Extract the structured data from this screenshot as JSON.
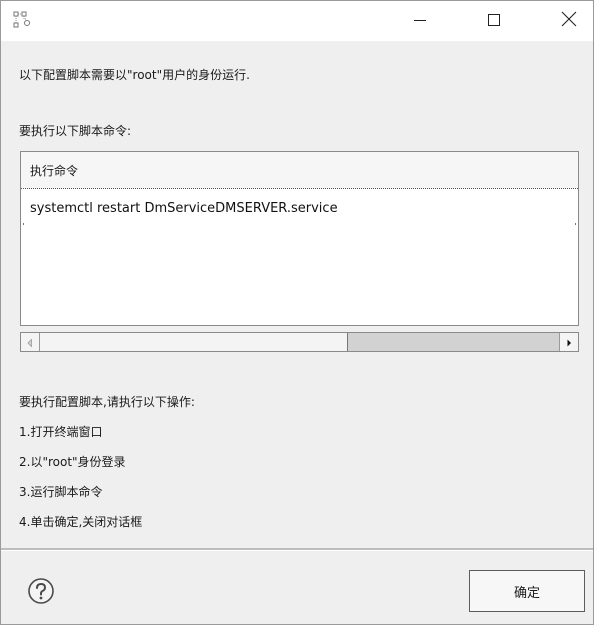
{
  "window": {
    "icon": "network-config-icon",
    "controls": {
      "minimize": "minimize-icon",
      "maximize": "maximize-icon",
      "close": "close-icon"
    }
  },
  "message": {
    "intro": "以下配置脚本需要以\"root\"用户的身份运行.",
    "commands_heading": "要执行以下脚本命令:"
  },
  "table": {
    "columns": [
      "执行命令"
    ],
    "rows": [
      [
        "systemctl restart DmServiceDMSERVER.service"
      ]
    ]
  },
  "instructions": {
    "heading": "要执行配置脚本,请执行以下操作:",
    "steps": [
      "1.打开终端窗口",
      "2.以\"root\"身份登录",
      "3.运行脚本命令",
      "4.单击确定,关闭对话框"
    ]
  },
  "footer": {
    "help_icon": "help-icon",
    "ok_label": "确定"
  }
}
